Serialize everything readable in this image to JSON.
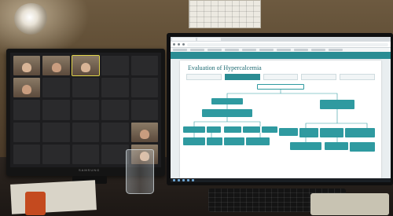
{
  "scene": {
    "description_tags": [
      "left-monitor-video-call",
      "right-monitor-browser-flowchart",
      "glass",
      "mug",
      "keyboard"
    ]
  },
  "left_monitor": {
    "brand": "SAMSUNG",
    "participants": [
      {
        "name": "",
        "video": true
      },
      {
        "name": "",
        "video": true
      },
      {
        "name": "",
        "video": true,
        "active": true
      },
      {
        "name": "",
        "video": false
      },
      {
        "name": "",
        "video": false
      },
      {
        "name": "",
        "video": true
      },
      {
        "name": "",
        "video": false
      },
      {
        "name": "",
        "video": false
      },
      {
        "name": "",
        "video": false
      },
      {
        "name": "",
        "video": false
      },
      {
        "name": "",
        "video": false
      },
      {
        "name": "",
        "video": false
      },
      {
        "name": "",
        "video": false
      },
      {
        "name": "",
        "video": false
      },
      {
        "name": "",
        "video": false
      },
      {
        "name": "",
        "video": false
      },
      {
        "name": "",
        "video": false
      },
      {
        "name": "",
        "video": false
      },
      {
        "name": "",
        "video": false
      },
      {
        "name": "",
        "video": true
      },
      {
        "name": "",
        "video": false
      },
      {
        "name": "",
        "video": false
      },
      {
        "name": "",
        "video": false
      },
      {
        "name": "",
        "video": false
      },
      {
        "name": "",
        "video": true
      }
    ]
  },
  "right_monitor": {
    "app_header_left": "",
    "app_header_right": "",
    "document_title": "Evaluation of Hypercalcemia",
    "tabs": [
      {
        "label": "",
        "active": false
      },
      {
        "label": "",
        "active": true
      },
      {
        "label": "",
        "active": false
      },
      {
        "label": "",
        "active": false
      },
      {
        "label": "",
        "active": false
      }
    ],
    "flow_nodes": [
      {
        "label": "",
        "style": "outline"
      },
      {
        "label": "",
        "style": "fill"
      },
      {
        "label": "",
        "style": "fill"
      },
      {
        "label": "",
        "style": "fill"
      },
      {
        "label": "",
        "style": "fill"
      },
      {
        "label": "",
        "style": "fill"
      },
      {
        "label": "",
        "style": "fill"
      },
      {
        "label": "",
        "style": "fill"
      },
      {
        "label": "",
        "style": "fill"
      },
      {
        "label": "",
        "style": "fill"
      },
      {
        "label": "",
        "style": "fill"
      },
      {
        "label": "",
        "style": "fill"
      },
      {
        "label": "",
        "style": "fill"
      },
      {
        "label": "",
        "style": "fill"
      },
      {
        "label": "",
        "style": "fill"
      },
      {
        "label": "",
        "style": "fill"
      },
      {
        "label": "",
        "style": "fill"
      },
      {
        "label": "",
        "style": "fill"
      },
      {
        "label": "",
        "style": "fill"
      },
      {
        "label": "",
        "style": "fill"
      }
    ]
  },
  "colors": {
    "app_accent": "#2a8c93",
    "node_fill": "#2f9aa0",
    "mug": "#c44a1f"
  }
}
